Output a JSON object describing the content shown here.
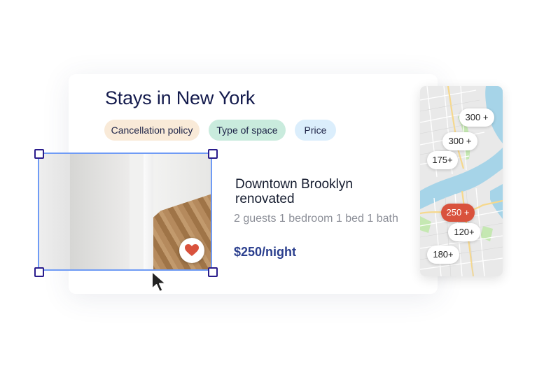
{
  "page": {
    "title": "Stays in New York"
  },
  "filters": [
    {
      "label": "Cancellation policy",
      "color": "#f9ead8"
    },
    {
      "label": "Type of space",
      "color": "#c9ebdd"
    },
    {
      "label": "Price",
      "color": "#dbeefc"
    }
  ],
  "listing": {
    "name": "Downtown Brooklyn renovated",
    "details": "2 guests 1 bedroom 1 bed 1 bath",
    "price": "$250/night",
    "favorited": true,
    "favorite_icon": "heart-icon",
    "favorite_color": "#d9523d"
  },
  "map": {
    "pins": [
      {
        "label": "300 +",
        "active": false
      },
      {
        "label": "300 +",
        "active": false
      },
      {
        "label": "175+",
        "active": false
      },
      {
        "label": "250 +",
        "active": true
      },
      {
        "label": "120+",
        "active": false
      },
      {
        "label": "180+",
        "active": false
      }
    ],
    "active_pin_color": "#d9523d"
  },
  "colors": {
    "title": "#141b4d",
    "price": "#2b3f8e",
    "selection": "#6f9bf5",
    "handle_border": "#2a1c8c"
  }
}
